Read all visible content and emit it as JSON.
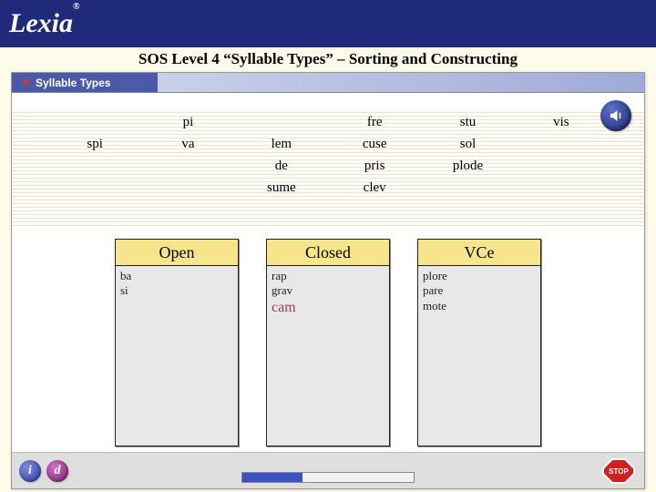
{
  "brand": {
    "name": "Lexia",
    "reg": "®"
  },
  "page_title": "SOS Level 4 “Syllable Types” – Sorting and Constructing",
  "window": {
    "title": "Syllable Types"
  },
  "speaker": {
    "name": "speaker-icon"
  },
  "syllables": {
    "rows": [
      [
        "",
        "pi",
        "",
        "fre",
        "stu",
        "vis"
      ],
      [
        "spi",
        "va",
        "lem",
        "cuse",
        "sol",
        ""
      ],
      [
        "",
        "",
        "de",
        "pris",
        "plode",
        ""
      ],
      [
        "",
        "",
        "sume",
        "clev",
        "",
        ""
      ]
    ]
  },
  "columns": [
    {
      "header": "Open",
      "items": [
        "ba",
        "si"
      ],
      "current": ""
    },
    {
      "header": "Closed",
      "items": [
        "rap",
        "grav"
      ],
      "current": "cam"
    },
    {
      "header": "VCe",
      "items": [
        "plore",
        "pare",
        "mote"
      ],
      "current": ""
    }
  ],
  "bottom": {
    "info_label": "i",
    "d_label": "d",
    "stop_label": "STOP",
    "progress_pct": 35
  }
}
